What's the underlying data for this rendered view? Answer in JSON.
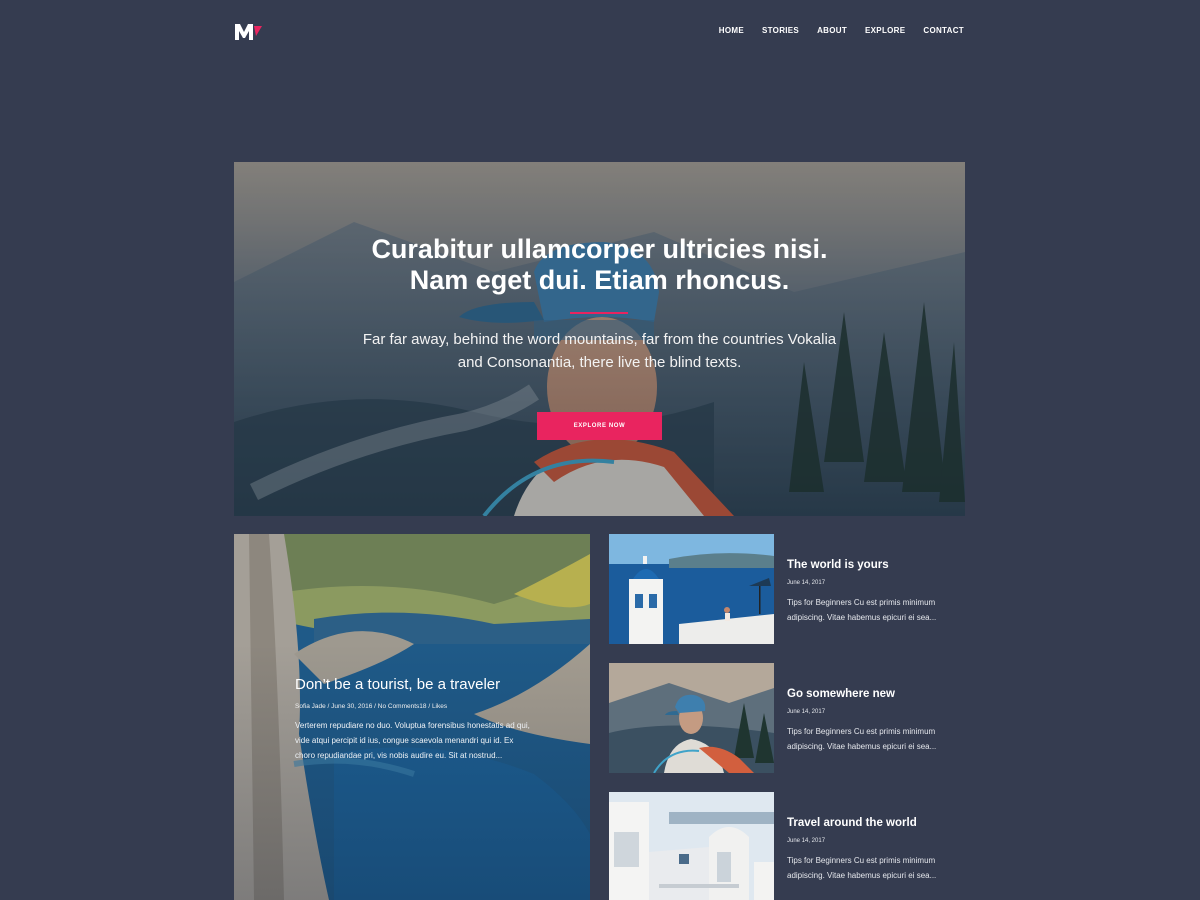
{
  "header": {
    "logo_icon": "m-brand-logo",
    "nav": [
      {
        "label": "HOME"
      },
      {
        "label": "STORIES"
      },
      {
        "label": "ABOUT"
      },
      {
        "label": "EXPLORE"
      },
      {
        "label": "CONTACT"
      }
    ]
  },
  "hero": {
    "title": "Curabitur ullamcorper ultricies nisi. Nam eget dui. Etiam rhoncus.",
    "text": "Far far away, behind the word mountains, far from the countries Vokalia and Consonantia, there live the blind texts.",
    "button_label": "EXPLORE NOW",
    "accent_color": "#e9245f"
  },
  "featured": {
    "title": "Don’t be a tourist, be a traveler",
    "meta": "Sofia Jade / June 30, 2016 / No Comments18 / Likes",
    "excerpt": "Verterem repudiare no duo. Voluptua forensibus honestatis ad qui, vide atqui percipit id ius, congue scaevola menandri qui id. Ex choro repudiandae pri, vis nobis audire eu. Sit at nostrud..."
  },
  "posts": [
    {
      "title": "The world is yours",
      "date": "June 14, 2017",
      "excerpt": "Tips for Beginners Cu est primis minimum adipiscing. Vitae habemus epicuri ei sea..."
    },
    {
      "title": "Go somewhere new",
      "date": "June 14, 2017",
      "excerpt": "Tips for Beginners Cu est primis minimum adipiscing. Vitae habemus epicuri ei sea..."
    },
    {
      "title": "Travel around the world",
      "date": "June 14, 2017",
      "excerpt": "Tips for Beginners Cu est primis minimum adipiscing. Vitae habemus epicuri ei sea..."
    }
  ],
  "colors": {
    "background": "#353c50",
    "accent": "#e9245f"
  }
}
